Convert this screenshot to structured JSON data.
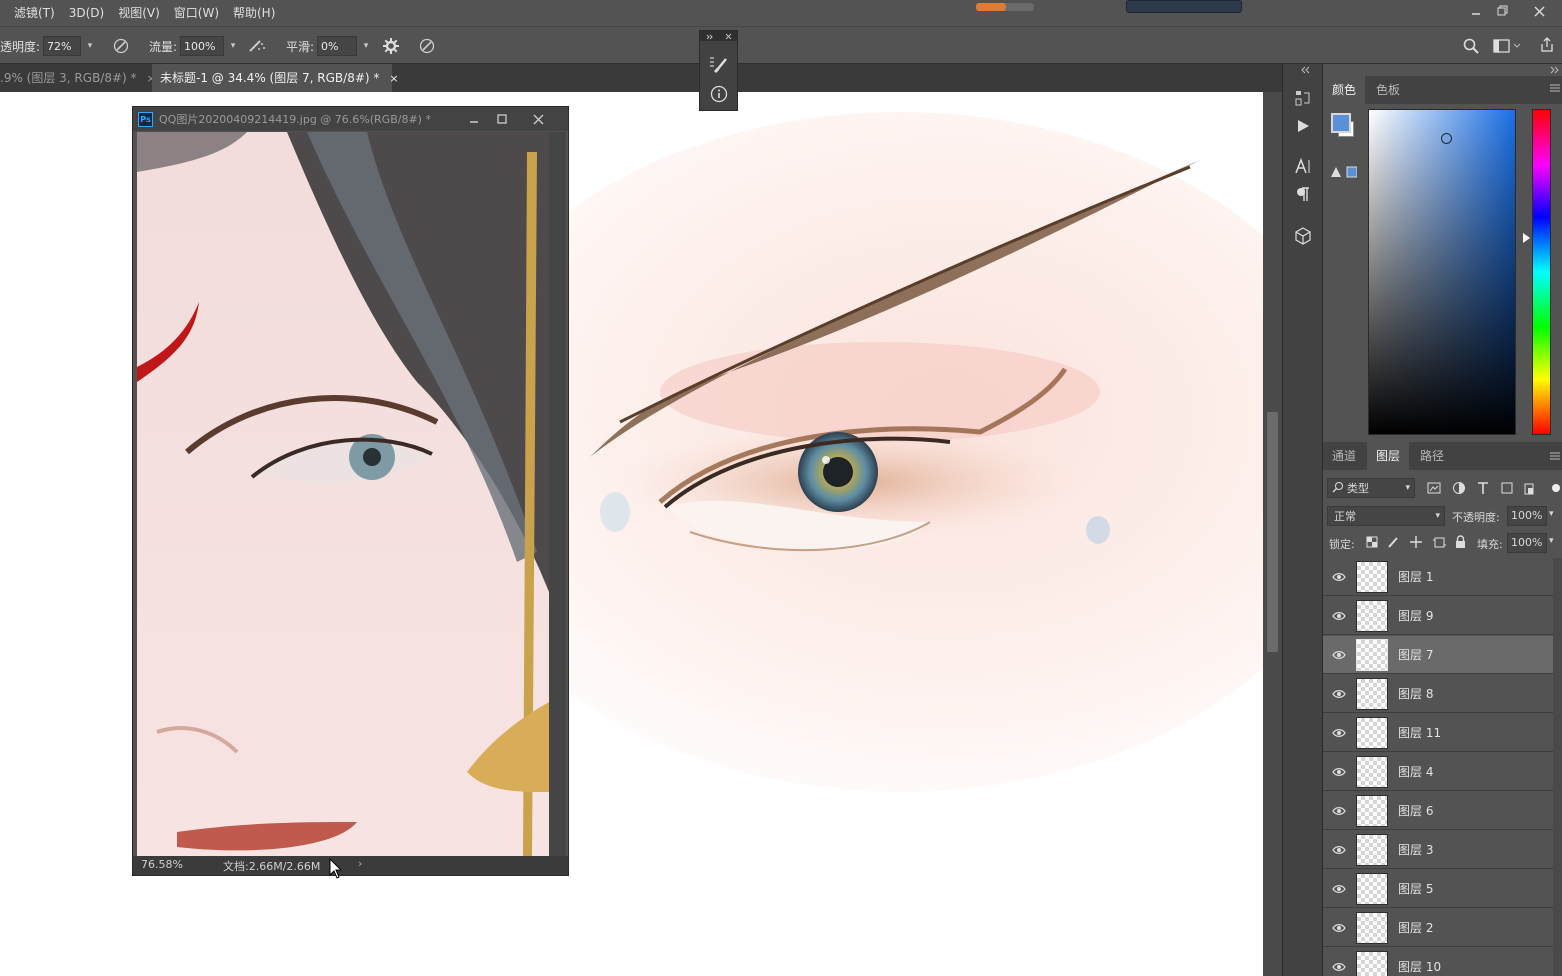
{
  "menu": [
    "滤镜(T)",
    "3D(D)",
    "视图(V)",
    "窗口(W)",
    "帮助(H)"
  ],
  "options": {
    "opacity_label": "透明度:",
    "opacity_value": "72%",
    "flow_label": "流量:",
    "flow_value": "100%",
    "smooth_label": "平滑:",
    "smooth_value": "0%"
  },
  "tabs": [
    {
      "label": ".9% (图层 3, RGB/8#) *",
      "close": "×"
    },
    {
      "label": "未标题-1 @ 34.4% (图层 7, RGB/8#) *",
      "close": "×"
    }
  ],
  "float_window": {
    "ps_badge": "Ps",
    "title": "QQ图片20200409214419.jpg @ 76.6%(RGB/8#) *",
    "zoom": "76.58%",
    "doc_info": "文档:2.66M/2.66M",
    "arrow": "›"
  },
  "color_panel": {
    "tabs": [
      "颜色",
      "色板"
    ],
    "foreground_color": "#5b8fd6",
    "background_color": "#ffffff"
  },
  "layers_panel": {
    "tabs": [
      "通道",
      "图层",
      "路径"
    ],
    "filter_label": "类型",
    "blend_mode": "正常",
    "opacity_label": "不透明度:",
    "opacity_value": "100%",
    "lock_label": "锁定:",
    "fill_label": "填充:",
    "fill_value": "100%",
    "layers": [
      {
        "name": "图层 1",
        "selected": false
      },
      {
        "name": "图层 9",
        "selected": false
      },
      {
        "name": "图层 7",
        "selected": true
      },
      {
        "name": "图层 8",
        "selected": false
      },
      {
        "name": "图层 11",
        "selected": false
      },
      {
        "name": "图层 4",
        "selected": false
      },
      {
        "name": "图层 6",
        "selected": false
      },
      {
        "name": "图层 3",
        "selected": false
      },
      {
        "name": "图层 5",
        "selected": false
      },
      {
        "name": "图层 2",
        "selected": false
      },
      {
        "name": "图层 10",
        "selected": false
      }
    ]
  }
}
